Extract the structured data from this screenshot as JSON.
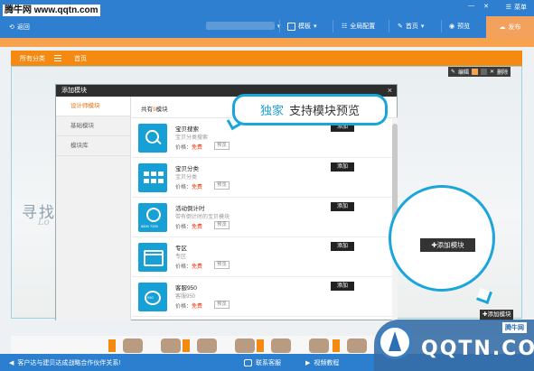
{
  "watermark": "腾牛网 www.qqtn.com",
  "topbar": {
    "back_label": "返回",
    "menu_label": "菜单",
    "account_label": "",
    "template_label": "模板",
    "global_config_label": "全局配置",
    "home_label": "首页",
    "preview_label": "预览",
    "publish_label": "发布"
  },
  "page": {
    "nav": {
      "all_categories": "所有分类",
      "home": "首页"
    },
    "banner_text": "寻找",
    "banner_script": "Lo",
    "edit_tools": {
      "edit": "编辑",
      "delete": "删除"
    }
  },
  "modal": {
    "title": "添加模块",
    "close": "×",
    "sidebar": [
      {
        "label": "设计师模块",
        "active": true
      },
      {
        "label": "基础模块",
        "active": false
      },
      {
        "label": "模块库",
        "active": false
      }
    ],
    "count_prefix": "共有",
    "count": "9",
    "count_suffix": "模块",
    "items": [
      {
        "name": "宝贝搜索",
        "desc": "宝贝分类搜索",
        "price_label": "价格：",
        "price": "免费",
        "preview": "预览",
        "add": "添加",
        "icon": "search-icon"
      },
      {
        "name": "宝贝分类",
        "desc": "宝贝分类",
        "price_label": "价格：",
        "price": "免费",
        "preview": "预览",
        "add": "添加",
        "icon": "grid-icon"
      },
      {
        "name": "活动倒计时",
        "desc": "带有倒计时的宝贝模块",
        "price_label": "价格：",
        "price": "免费",
        "preview": "预览",
        "add": "添加",
        "icon": "clock-icon"
      },
      {
        "name": "专区",
        "desc": "专区",
        "price_label": "价格：",
        "price": "免费",
        "preview": "预览",
        "add": "添加",
        "icon": "window-icon"
      },
      {
        "name": "客服950",
        "desc": "客服950",
        "price_label": "价格：",
        "price": "免费",
        "preview": "预览",
        "add": "添加",
        "icon": "service-icon"
      }
    ]
  },
  "callout": {
    "highlight": "独家",
    "text": "支持模块预览"
  },
  "circle_button": "添加模块",
  "small_add_button": "添加模块",
  "footer": {
    "message": "客户达与建贝达成战略合作伙伴关系!",
    "customer_service": "联系客服",
    "video_tutorial": "视频教程"
  },
  "badge": {
    "tag": "腾牛网",
    "brand": "QQTN.COM",
    "sub": ""
  },
  "colors": {
    "topbar": "#2f7fd0",
    "accent_orange": "#f48a12",
    "callout_blue": "#1aa6db",
    "free_red": "#e8370c"
  }
}
